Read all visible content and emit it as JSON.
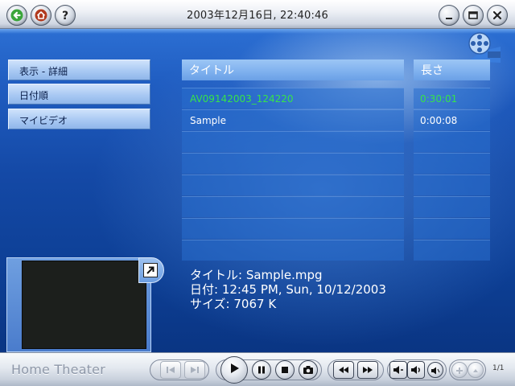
{
  "window": {
    "datetime": "2003年12月16日, 22:40:46"
  },
  "menu": {
    "items": [
      {
        "label": "表示 - 詳細"
      },
      {
        "label": "日付順"
      },
      {
        "label": "マイビデオ"
      }
    ]
  },
  "list": {
    "headers": {
      "title": "タイトル",
      "length": "長さ"
    },
    "rows": [
      {
        "title": "AV09142003_124220",
        "length": "0:30:01",
        "highlighted": true
      },
      {
        "title": "Sample",
        "length": "0:00:08",
        "highlighted": false
      },
      {
        "title": "",
        "length": ""
      },
      {
        "title": "",
        "length": ""
      },
      {
        "title": "",
        "length": ""
      },
      {
        "title": "",
        "length": ""
      },
      {
        "title": "",
        "length": ""
      },
      {
        "title": "",
        "length": ""
      }
    ]
  },
  "details": {
    "title": "タイトル: Sample.mpg",
    "date": "日付: 12:45 PM, Sun, 10/12/2003",
    "size": "サイズ: 7067 K"
  },
  "footer": {
    "brand": "Home Theater",
    "page_count": "1/1"
  },
  "colors": {
    "highlight_text": "#36e34a",
    "background_blue": "#1449a6",
    "header_blue": "#7eb0ee"
  },
  "icons": {
    "back": "back-arrow-icon",
    "home": "home-icon",
    "help": "help-icon",
    "minimize": "minimize-icon",
    "restore": "restore-icon",
    "close": "close-icon",
    "logo": "film-reel-logo-icon"
  }
}
